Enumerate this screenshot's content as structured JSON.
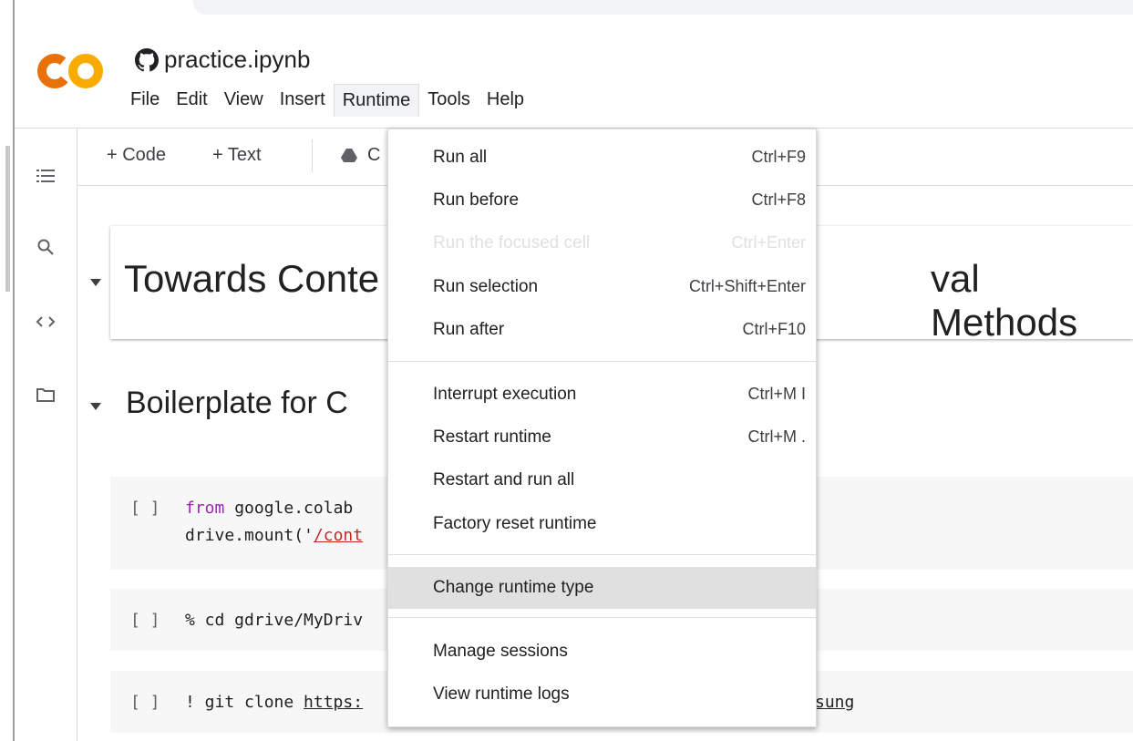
{
  "notebook": {
    "title": "practice.ipynb"
  },
  "menubar": [
    "File",
    "Edit",
    "View",
    "Insert",
    "Runtime",
    "Tools",
    "Help"
  ],
  "toolbar": {
    "code_label": "+ Code",
    "text_label": "+ Text",
    "copy_label_partial": "C"
  },
  "content": {
    "heading1_left": "Towards Conte",
    "heading1_right": "val Methods",
    "heading2_left": "Boilerplate for C",
    "cells": [
      {
        "bracket": "[ ]",
        "line1_kw": "from",
        "line1_rest": " google.colab",
        "line2_pre": "drive.mount('",
        "line2_str": "/cont"
      },
      {
        "bracket": "[ ]",
        "line1": "% cd gdrive/MyDriv"
      },
      {
        "bracket": "[ ]",
        "line1_pre": "! git clone ",
        "line1_url": "https:",
        "line1_tail": "sung"
      }
    ]
  },
  "runtime_menu": {
    "groups": [
      [
        {
          "label": "Run all",
          "shortcut": "Ctrl+F9",
          "enabled": true
        },
        {
          "label": "Run before",
          "shortcut": "Ctrl+F8",
          "enabled": true
        },
        {
          "label": "Run the focused cell",
          "shortcut": "Ctrl+Enter",
          "enabled": false
        },
        {
          "label": "Run selection",
          "shortcut": "Ctrl+Shift+Enter",
          "enabled": true
        },
        {
          "label": "Run after",
          "shortcut": "Ctrl+F10",
          "enabled": true
        }
      ],
      [
        {
          "label": "Interrupt execution",
          "shortcut": "Ctrl+M I",
          "enabled": true
        },
        {
          "label": "Restart runtime",
          "shortcut": "Ctrl+M .",
          "enabled": true
        },
        {
          "label": "Restart and run all",
          "shortcut": "",
          "enabled": true
        },
        {
          "label": "Factory reset runtime",
          "shortcut": "",
          "enabled": true
        }
      ],
      [
        {
          "label": "Change runtime type",
          "shortcut": "",
          "enabled": true,
          "highlighted": true
        }
      ],
      [
        {
          "label": "Manage sessions",
          "shortcut": "",
          "enabled": true
        },
        {
          "label": "View runtime logs",
          "shortcut": "",
          "enabled": true
        }
      ]
    ]
  },
  "colors": {
    "logo_orange": "#F9AB00",
    "logo_dark_orange": "#E8710A",
    "keyword": "#9c27b0",
    "string": "#c62828"
  },
  "icons": [
    "github-icon",
    "toc-icon",
    "search-icon",
    "code-snippets-icon",
    "files-icon",
    "drive-icon",
    "chevron-down-icon"
  ]
}
